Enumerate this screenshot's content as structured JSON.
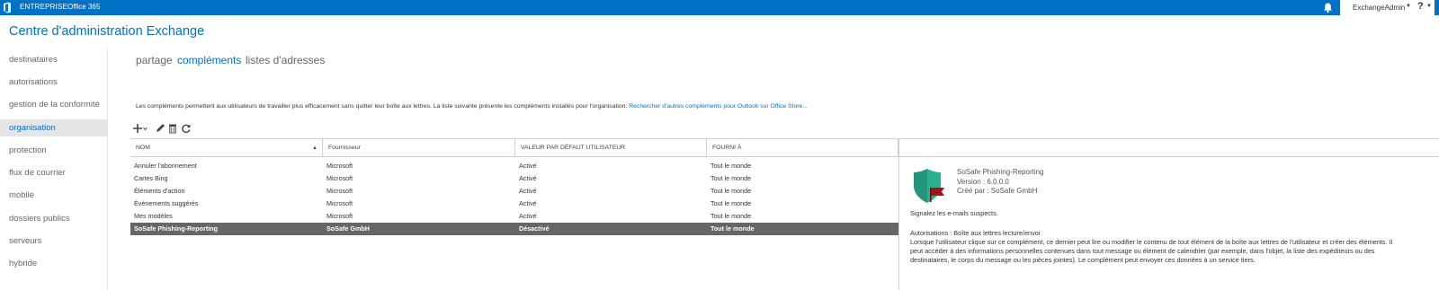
{
  "topbar": {
    "brand": "ENTREPRISE",
    "product": "Office 365",
    "user": "ExchangeAdmin",
    "help": "?",
    "icons": {
      "logo": "office-logo-icon",
      "bell": "bell-icon"
    }
  },
  "page_title": "Centre d'administration Exchange",
  "sidebar": {
    "items": [
      {
        "label": "destinataires"
      },
      {
        "label": "autorisations"
      },
      {
        "label": "gestion de la conformité"
      },
      {
        "label": "organisation",
        "active": true
      },
      {
        "label": "protection"
      },
      {
        "label": "flux de courrier"
      },
      {
        "label": "mobile"
      },
      {
        "label": "dossiers publics"
      },
      {
        "label": "serveurs"
      },
      {
        "label": "hybride"
      }
    ]
  },
  "tabs": [
    {
      "label": "partage"
    },
    {
      "label": "compléments",
      "active": true
    },
    {
      "label": "listes d'adresses"
    }
  ],
  "description": {
    "text": "Les compléments permettent aux utilisateurs de travailler plus efficacement sans quitter leur boîte aux lettres. La liste suivante présente les compléments installés pour l'organisation.",
    "link": "Rechercher d'autres compléments pour Outlook sur Office Store..."
  },
  "toolbar": {
    "icons": [
      "add-icon",
      "edit-icon",
      "delete-icon",
      "refresh-icon"
    ]
  },
  "table": {
    "columns": [
      "NOM",
      "Fournisseur",
      "VALEUR PAR DÉFAUT UTILISATEUR",
      "FOURNI À"
    ],
    "sort_indicator": "▲",
    "rows": [
      {
        "name": "Annuler l'abonnement",
        "provider": "Microsoft",
        "default": "Activé",
        "provided_to": "Tout le monde"
      },
      {
        "name": "Cartes Bing",
        "provider": "Microsoft",
        "default": "Activé",
        "provided_to": "Tout le monde"
      },
      {
        "name": "Éléments d'action",
        "provider": "Microsoft",
        "default": "Activé",
        "provided_to": "Tout le monde"
      },
      {
        "name": "Événements suggérés",
        "provider": "Microsoft",
        "default": "Activé",
        "provided_to": "Tout le monde"
      },
      {
        "name": "Mes modèles",
        "provider": "Microsoft",
        "default": "Activé",
        "provided_to": "Tout le monde"
      },
      {
        "name": "SoSafe Phishing-Reporting",
        "provider": "SoSafe GmbH",
        "default": "Désactivé",
        "provided_to": "Tout le monde",
        "selected": true
      }
    ]
  },
  "detail": {
    "name": "SoSafe Phishing-Reporting",
    "version": "Version : 6.0.0.0",
    "created_by": "Créé par : SoSafe GmbH",
    "tagline": "Signalez les e-mails suspects.",
    "permissions_label": "Autorisations : Boîte aux lettres lecture/envoi",
    "permissions_text": "Lorsque l'utilisateur clique sur ce complément, ce dernier peut lire ou modifier le contenu de tout élément de la boîte aux lettres de l'utilisateur et créer des éléments. Il peut accéder à des informations personnelles contenues dans tout message ou élément de calendrier (par exemple, dans l'objet, la liste des expéditeurs ou des destinataires, le corps du message ou les pièces jointes). Le complément peut envoyer ces données à un service tiers.",
    "icon": "sosafe-shield-icon",
    "colors": {
      "shield": "#2bb08c",
      "flag": "#a3131e"
    }
  },
  "colors": {
    "accent": "#0072c6",
    "selected_row": "#666666",
    "nav_active_bg": "#e6e6e6"
  }
}
